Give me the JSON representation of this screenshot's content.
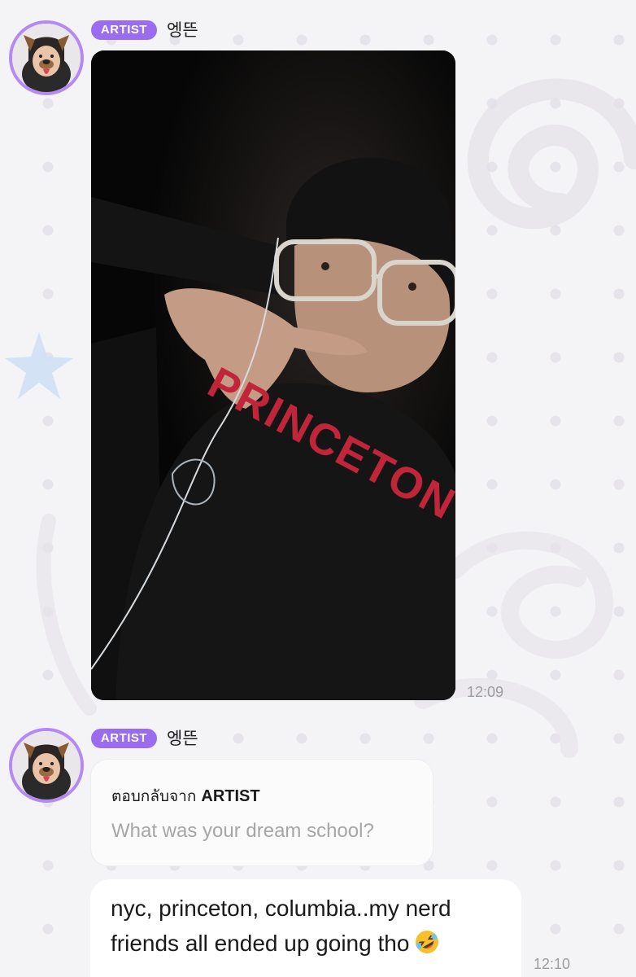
{
  "messages": [
    {
      "badge": "ARTIST",
      "sender": "엥뜬",
      "time": "12:09"
    },
    {
      "badge": "ARTIST",
      "sender": "엥뜬",
      "reply": {
        "prefix": "ตอบกลับจาก",
        "target": "ARTIST",
        "question": "What was your dream school?"
      },
      "text_line1": "nyc, princeton, columbia..my nerd",
      "text_line2": "friends all ended up going tho",
      "emoji": "rolling-on-floor-laughing-emoji",
      "time": "12:10"
    }
  ],
  "photo": {
    "shirt_text": "PRINCETON"
  },
  "colors": {
    "badge": "#9a6cf0",
    "avatar_ring": "#b589f3",
    "time": "#9c9c9c",
    "reply_question": "#a6a6a6"
  }
}
